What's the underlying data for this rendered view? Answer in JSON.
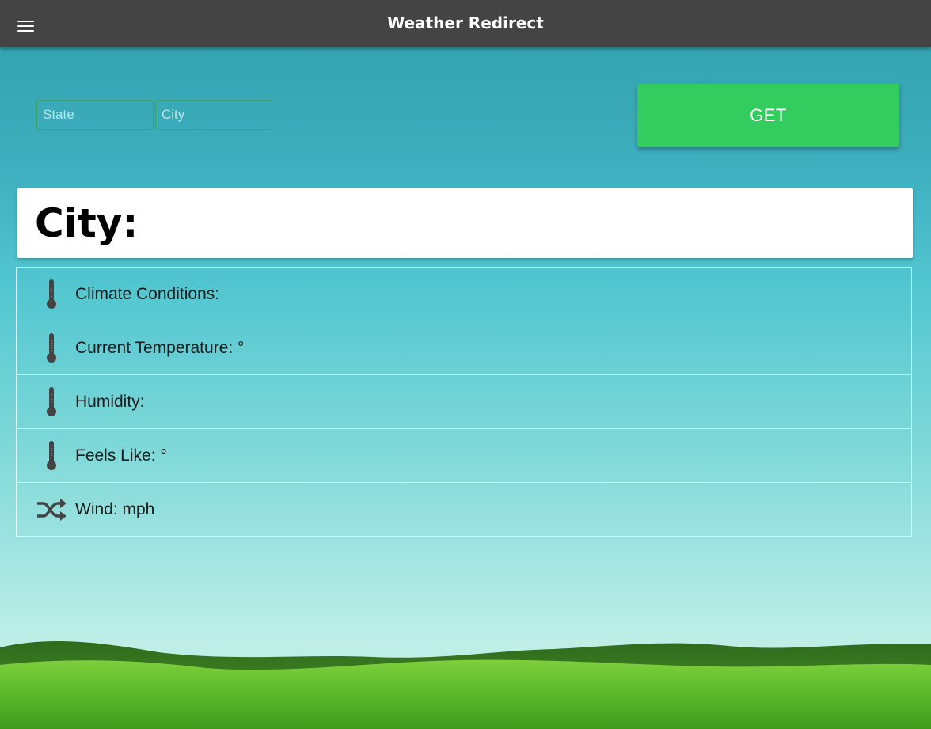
{
  "header": {
    "title": "Weather Redirect",
    "menu_icon": "hamburger-menu-icon"
  },
  "search": {
    "state_placeholder": "State",
    "city_placeholder": "City",
    "state_value": "",
    "city_value": "",
    "get_label": "GET"
  },
  "city_card": {
    "heading": "City:"
  },
  "weather": {
    "items": [
      {
        "label": "Climate Conditions:",
        "icon": "thermometer-icon"
      },
      {
        "label": "Current Temperature: °",
        "icon": "thermometer-icon"
      },
      {
        "label": "Humidity:",
        "icon": "thermometer-icon"
      },
      {
        "label": "Feels Like: °",
        "icon": "thermometer-icon"
      },
      {
        "label": "Wind: mph",
        "icon": "shuffle-icon"
      }
    ]
  },
  "colors": {
    "topbar": "#444444",
    "get_button": "#33cc5e",
    "sky_top": "#2f9fac",
    "sky_bottom": "#bfeee6",
    "grass": "#5fbf2a"
  }
}
